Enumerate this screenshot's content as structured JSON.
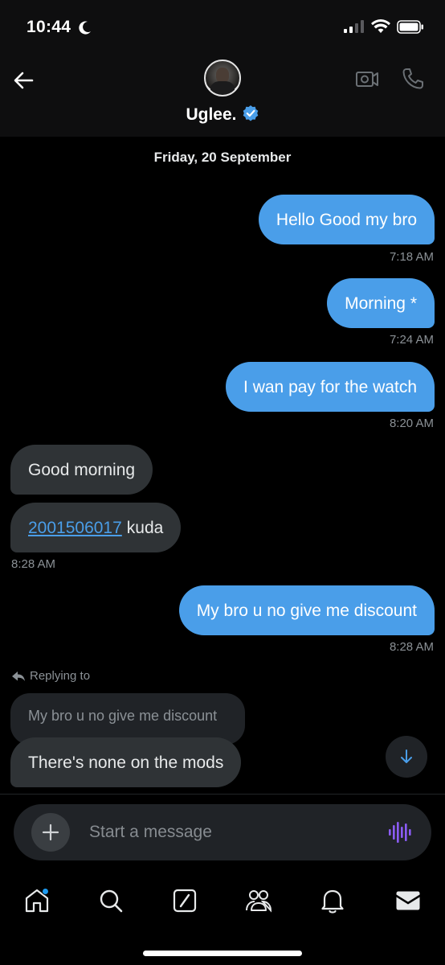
{
  "status_bar": {
    "time": "10:44"
  },
  "header": {
    "contact_name": "Uglee."
  },
  "chat": {
    "date_separator": "Friday, 20 September",
    "messages": [
      {
        "dir": "out",
        "text": "Hello  Good my bro",
        "time": "7:18 AM"
      },
      {
        "dir": "out",
        "text": "Morning *",
        "time": "7:24 AM"
      },
      {
        "dir": "out",
        "text": "I wan pay for the watch",
        "time": "8:20 AM"
      },
      {
        "dir": "in",
        "text": "Good morning"
      },
      {
        "dir": "in",
        "link": "2001506017",
        "text": "kuda",
        "time": "8:28 AM"
      },
      {
        "dir": "out",
        "text": "My bro u no give me discount",
        "time": "8:28 AM"
      }
    ],
    "reply": {
      "label": "Replying to",
      "quoted_text": "My bro u no give me discount",
      "text": "There's none on the mods"
    }
  },
  "composer": {
    "placeholder": "Start a message"
  },
  "nav": {
    "items": [
      "home-icon",
      "search-icon",
      "grok-icon",
      "communities-icon",
      "notifications-icon",
      "messages-icon"
    ]
  },
  "colors": {
    "accent": "#4a9ee9",
    "bubble_in": "#2f3336",
    "background": "#000000",
    "voice": "#8b5cf6"
  }
}
